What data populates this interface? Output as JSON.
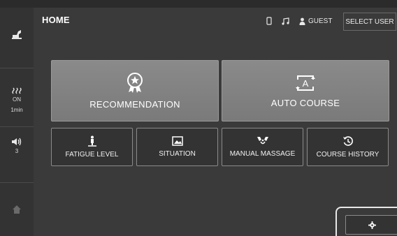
{
  "header": {
    "title": "HOME",
    "user_label": "GUEST",
    "select_user_label": "SELECT USER"
  },
  "sidebar": {
    "heat_status": "ON",
    "heat_timer": "1min",
    "volume_level": "3"
  },
  "main_buttons": {
    "recommendation": "RECOMMENDATION",
    "auto_course": "AUTO COURSE"
  },
  "sub_buttons": {
    "fatigue_level": "FATIGUE LEVEL",
    "situation": "SITUATION",
    "manual_massage": "MANUAL MASSAGE",
    "course_history": "COURSE HISTORY"
  },
  "icons": [
    "chair-icon",
    "heat-icon",
    "volume-icon",
    "home-icon",
    "phone-icon",
    "music-icon",
    "user-icon",
    "award-icon",
    "auto-course-icon",
    "fatigue-person-icon",
    "image-icon",
    "massage-icon",
    "history-icon",
    "gear-icon"
  ],
  "colors": {
    "background": "#2b2b2b",
    "big_button": "#808080",
    "text": "#ffffff"
  }
}
